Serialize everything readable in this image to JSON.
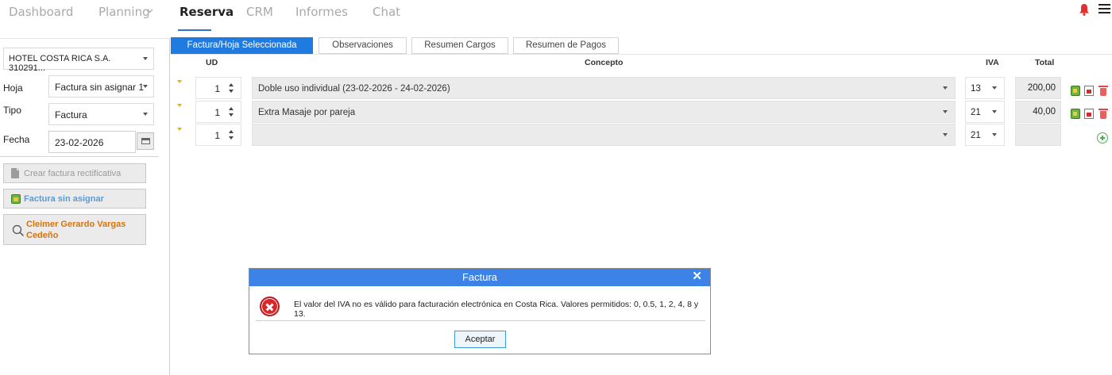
{
  "nav": {
    "items": [
      "Dashboard",
      "Planning",
      "Reserva",
      "CRM",
      "Informes",
      "Chat"
    ],
    "active": "Reserva"
  },
  "sidebar": {
    "hotel": "HOTEL COSTA RICA S.A. 310291...",
    "hoja_label": "Hoja",
    "hoja_value": "Factura  sin asignar 1",
    "tipo_label": "Tipo",
    "tipo_value": "Factura",
    "fecha_label": "Fecha",
    "fecha_value": "23-02-2026",
    "btn_rectificativa": "Crear factura rectificativa",
    "btn_sin_asignar": "Factura sin asignar",
    "btn_client_line1": "Cleimer Gerardo Vargas",
    "btn_client_line2": "Cedeño"
  },
  "tabs": [
    "Factura/Hoja Seleccionada",
    "Observaciones",
    "Resumen Cargos",
    "Resumen de Pagos"
  ],
  "table": {
    "headers": {
      "ud": "UD",
      "concepto": "Concepto",
      "iva": "IVA",
      "total": "Total"
    },
    "rows": [
      {
        "ud": "1",
        "concepto": "Doble uso individual (23-02-2026 - 24-02-2026)",
        "iva": "13",
        "total": "200,00"
      },
      {
        "ud": "1",
        "concepto": "Extra Masaje por pareja",
        "iva": "21",
        "total": "40,00"
      },
      {
        "ud": "1",
        "concepto": "",
        "iva": "21",
        "total": ""
      }
    ]
  },
  "dialog": {
    "title": "Factura",
    "close": "✕",
    "message": "El valor del IVA no es válido para facturación electrónica en Costa Rica. Valores permitidos: 0, 0.5, 1, 2, 4, 8 y 13.",
    "button": "Aceptar"
  },
  "colors": {
    "accent": "#1f7be0",
    "dialog_header": "#3d82e6",
    "error": "#d9262a",
    "client_text": "#d7730b",
    "link_blue": "#5b9bd5"
  }
}
